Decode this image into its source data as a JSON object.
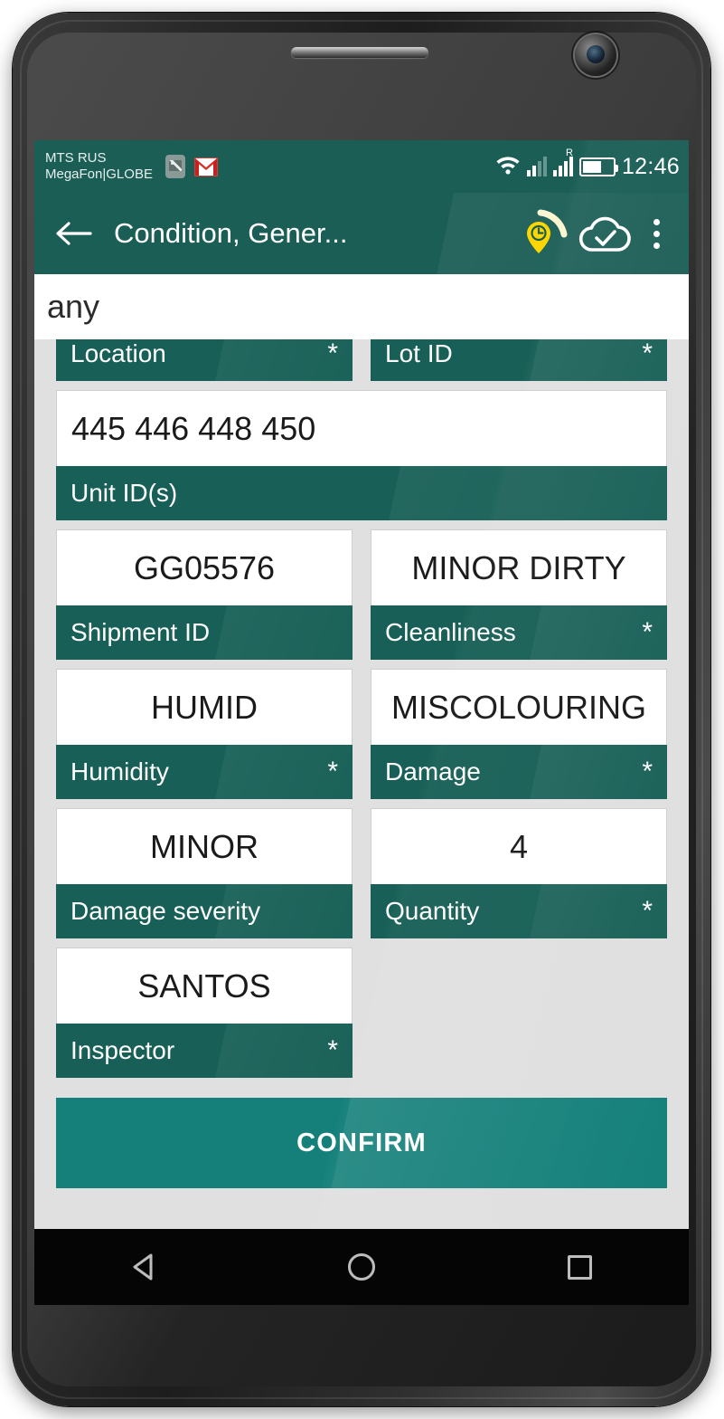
{
  "status_bar": {
    "carrier_line1": "MTS RUS",
    "carrier_line2": "MegaFon|GLOBE",
    "notification_icons": [
      "image-icon",
      "gmail-icon"
    ],
    "wifi_icon": "wifi-icon",
    "signal_icon": "signal-bars-icon",
    "roaming_signal_icon": "signal-bars-roaming-icon",
    "roaming_badge": "R",
    "battery_icon": "battery-icon",
    "clock": "12:46",
    "background_color": "#1b5e56"
  },
  "app_bar": {
    "back_icon": "back-arrow-icon",
    "title": "Condition, Gener...",
    "location_icon": "location-pin-clock-icon",
    "cloud_icon": "cloud-check-icon",
    "overflow_icon": "overflow-menu-icon",
    "background_color": "#1b5e56",
    "accent_color": "#ffd600"
  },
  "search": {
    "value": "any",
    "placeholder": "any"
  },
  "form": {
    "required_marker": "*",
    "label_color": "#186057",
    "rows": [
      {
        "clipped": true,
        "fields": [
          {
            "label": "Location",
            "value": "",
            "required": true
          },
          {
            "label": "Lot ID",
            "value": "",
            "required": true
          }
        ]
      },
      {
        "clipped": false,
        "fields": [
          {
            "label": "Unit ID(s)",
            "value": "445 446 448 450",
            "required": false,
            "full": true,
            "align": "left"
          }
        ]
      },
      {
        "clipped": false,
        "fields": [
          {
            "label": "Shipment ID",
            "value": "GG05576",
            "required": false
          },
          {
            "label": "Cleanliness",
            "value": "MINOR DIRTY",
            "required": true
          }
        ]
      },
      {
        "clipped": false,
        "fields": [
          {
            "label": "Humidity",
            "value": "HUMID",
            "required": true
          },
          {
            "label": "Damage",
            "value": "MISCOLOURING",
            "required": true
          }
        ]
      },
      {
        "clipped": false,
        "fields": [
          {
            "label": "Damage severity",
            "value": "MINOR",
            "required": false
          },
          {
            "label": "Quantity",
            "value": "4",
            "required": true
          }
        ]
      },
      {
        "clipped": false,
        "fields": [
          {
            "label": "Inspector",
            "value": "SANTOS",
            "required": true
          },
          {
            "label": "",
            "value": "",
            "required": false,
            "empty": true
          }
        ]
      }
    ]
  },
  "confirm": {
    "label": "CONFIRM",
    "color": "#15807a"
  },
  "nav_bar": {
    "back_icon": "nav-back-icon",
    "home_icon": "nav-home-icon",
    "recents_icon": "nav-recents-icon"
  }
}
